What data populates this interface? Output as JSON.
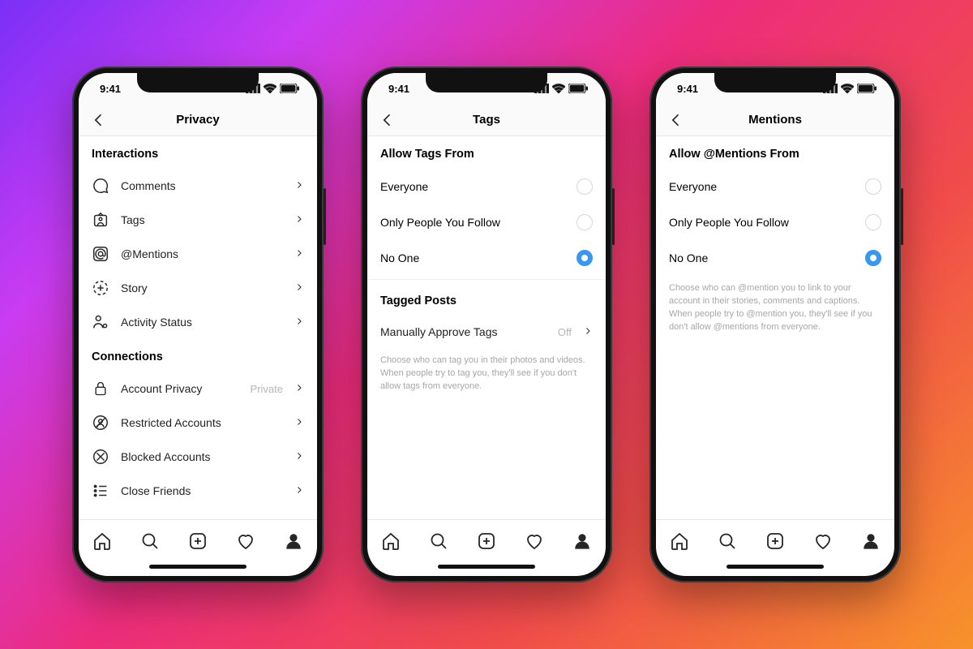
{
  "status_time": "9:41",
  "colors": {
    "accent": "#3897f0"
  },
  "screens": [
    {
      "title": "Privacy",
      "sections": [
        {
          "header": "Interactions",
          "items": [
            {
              "icon": "comment-icon",
              "label": "Comments"
            },
            {
              "icon": "tag-icon",
              "label": "Tags"
            },
            {
              "icon": "mention-icon",
              "label": "@Mentions"
            },
            {
              "icon": "story-icon",
              "label": "Story"
            },
            {
              "icon": "activity-icon",
              "label": "Activity Status"
            }
          ]
        },
        {
          "header": "Connections",
          "items": [
            {
              "icon": "lock-icon",
              "label": "Account Privacy",
              "value": "Private"
            },
            {
              "icon": "restricted-icon",
              "label": "Restricted Accounts"
            },
            {
              "icon": "blocked-icon",
              "label": "Blocked Accounts"
            },
            {
              "icon": "closefriends-icon",
              "label": "Close Friends"
            }
          ]
        }
      ]
    },
    {
      "title": "Tags",
      "radio_header": "Allow Tags From",
      "options": [
        {
          "label": "Everyone",
          "selected": false
        },
        {
          "label": "Only People You Follow",
          "selected": false
        },
        {
          "label": "No One",
          "selected": true
        }
      ],
      "sub_header": "Tagged Posts",
      "sub_row": {
        "label": "Manually Approve Tags",
        "value": "Off"
      },
      "help": "Choose who can tag you in their photos and videos. When people try to tag you, they'll see if you don't allow tags from everyone."
    },
    {
      "title": "Mentions",
      "radio_header": "Allow @Mentions From",
      "options": [
        {
          "label": "Everyone",
          "selected": false
        },
        {
          "label": "Only People You Follow",
          "selected": false
        },
        {
          "label": "No One",
          "selected": true
        }
      ],
      "help": "Choose who can @mention you to link to your account in their stories, comments and captions. When people try to @mention you, they'll see if you don't allow @mentions from everyone."
    }
  ],
  "tabbar": [
    "home-icon",
    "search-icon",
    "newpost-icon",
    "activity-heart-icon",
    "profile-icon"
  ]
}
